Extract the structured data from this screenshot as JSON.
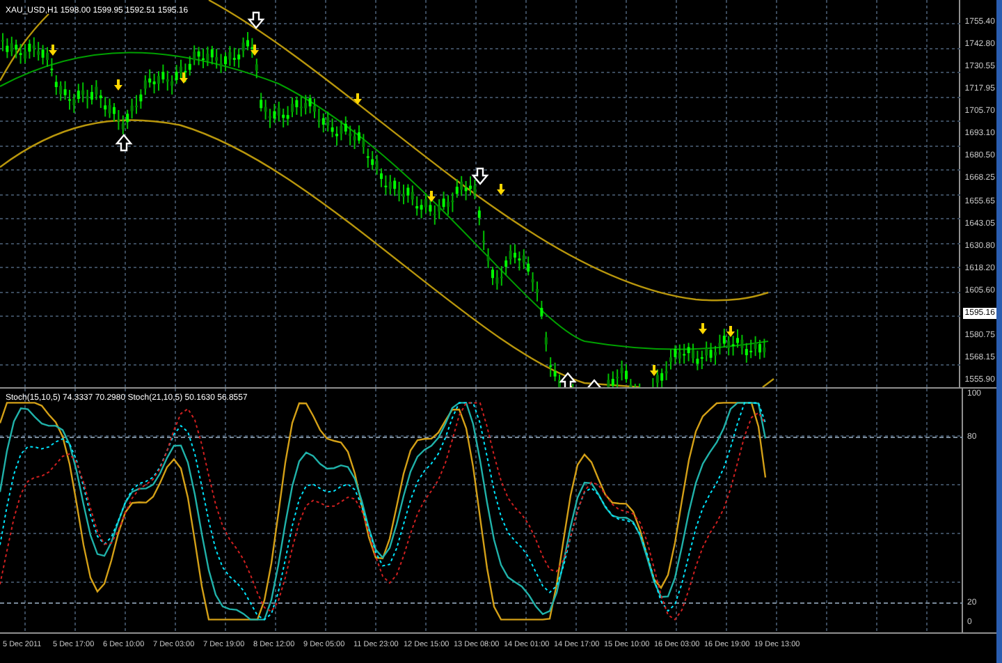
{
  "chart": {
    "header": "XAU_USD,H1  1598.00 1599.95 1592.51 1595.16",
    "price_axis": [
      {
        "label": "1755.40",
        "current": false
      },
      {
        "label": "1742.80",
        "current": false
      },
      {
        "label": "1730.55",
        "current": false
      },
      {
        "label": "1717.95",
        "current": false
      },
      {
        "label": "1705.70",
        "current": false
      },
      {
        "label": "1693.10",
        "current": false
      },
      {
        "label": "1680.50",
        "current": false
      },
      {
        "label": "1668.25",
        "current": false
      },
      {
        "label": "1655.65",
        "current": false
      },
      {
        "label": "1643.05",
        "current": false
      },
      {
        "label": "1630.80",
        "current": false
      },
      {
        "label": "1618.20",
        "current": false
      },
      {
        "label": "1605.60",
        "current": false
      },
      {
        "label": "1595.16",
        "current": true
      },
      {
        "label": "1580.75",
        "current": false
      },
      {
        "label": "1568.15",
        "current": false
      },
      {
        "label": "1555.90",
        "current": false
      }
    ]
  },
  "oscillator": {
    "header": "Stoch(15,10,5) 74.3337 70.2980  Stoch(21,10,5) 50.1630 56.8557",
    "axis": [
      "100",
      "80",
      "20",
      "0"
    ]
  },
  "time_axis": [
    "5 Dec 2011",
    "5 Dec 17:00",
    "6 Dec 10:00",
    "7 Dec 03:00",
    "7 Dec 19:00",
    "8 Dec 12:00",
    "9 Dec 05:00",
    "11 Dec 23:00",
    "12 Dec 15:00",
    "13 Dec 08:00",
    "14 Dec 01:00",
    "14 Dec 17:00",
    "15 Dec 10:00",
    "16 Dec 03:00",
    "16 Dec 19:00",
    "19 Dec 13:00"
  ]
}
